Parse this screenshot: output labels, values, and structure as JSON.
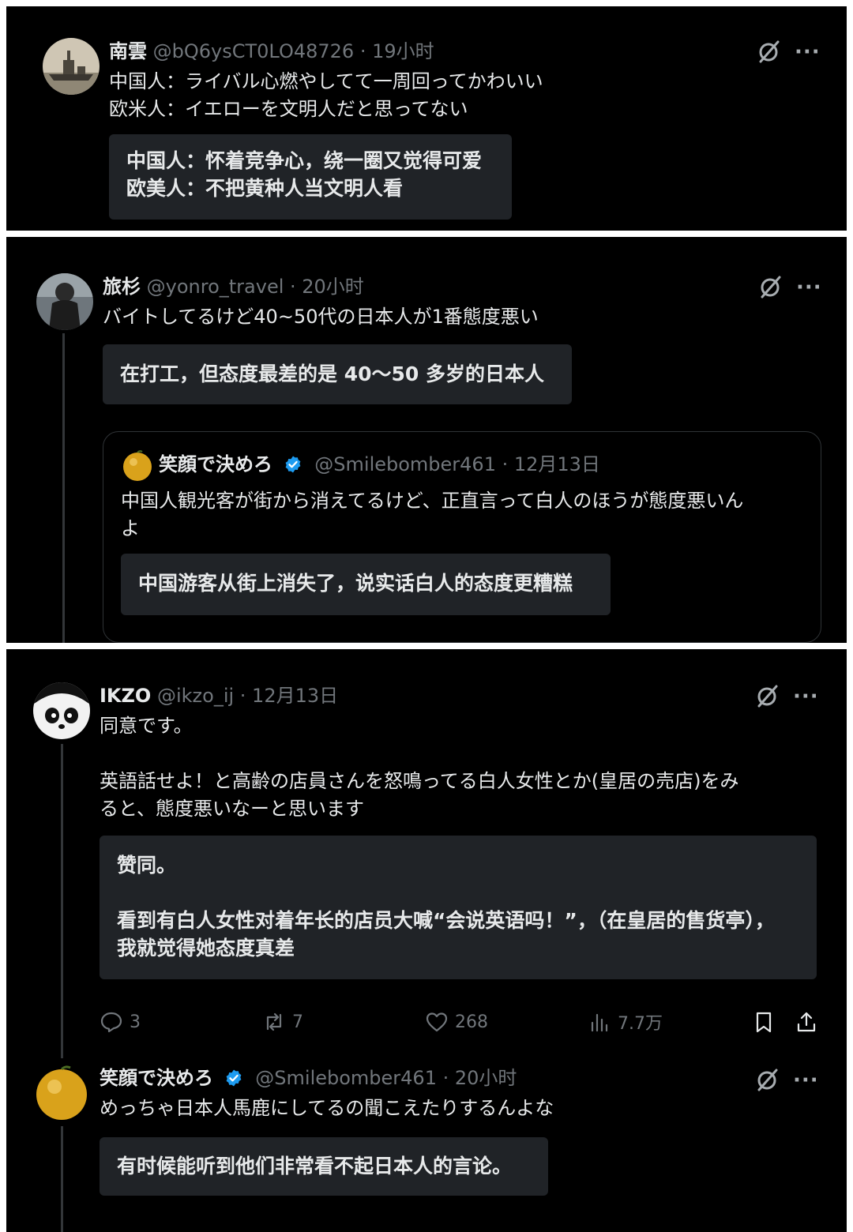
{
  "icons": {
    "grok": "grok-slash-icon",
    "more": "more-dots-icon",
    "verified": "verified-badge-icon",
    "reply": "reply-bubble-icon",
    "retweet": "retweet-icon",
    "like": "heart-icon",
    "views": "bar-chart-icon",
    "bookmark": "bookmark-icon",
    "share": "share-upload-icon"
  },
  "colors": {
    "background": "#000000",
    "translation_box": "#202327",
    "verified": "#1d9bf0",
    "muted": "#71767b"
  },
  "more_label": "···",
  "post1": {
    "name": "南雲",
    "meta": "@bQ6ysCT0LO48726 · 19小时",
    "lines": [
      "中国人：ライバル心燃やしてて一周回ってかわいい",
      "欧米人：イエローを文明人だと思ってない"
    ],
    "translation": [
      "中国人：怀着竞争心，绕一圈又觉得可爱",
      "欧美人：不把黄种人当文明人看"
    ]
  },
  "post2": {
    "name": "旅杉",
    "meta": "@yonro_travel · 20小时",
    "line": "バイトしてるけど40~50代の日本人が1番態度悪い",
    "translation": "在打工，但态度最差的是 40～50 多岁的日本人",
    "quote": {
      "name": "笑顔で決めろ",
      "meta": "@Smilebomber461 · 12月13日",
      "lines": [
        "中国人観光客が街から消えてるけど、正直言って白人のほうが態度悪いん",
        "よ"
      ],
      "translation": "中国游客从街上消失了，说实话白人的态度更糟糕"
    }
  },
  "post3": {
    "name": "IKZO",
    "meta": "@ikzo_ij · 12月13日",
    "line1": "同意です。",
    "lines": [
      "英語話せよ！と高齢の店員さんを怒鳴ってる白人女性とか(皇居の売店)をみ",
      "ると、態度悪いなーと思います"
    ],
    "translation": [
      "赞同。",
      "看到有白人女性对着年长的店员大喊“会说英语吗！”，（在皇居的售货亭），",
      "我就觉得她态度真差"
    ],
    "stats": {
      "replies": "3",
      "retweets": "7",
      "likes": "268",
      "views": "7.7万"
    }
  },
  "post4": {
    "name": "笑顔で決めろ",
    "meta": "@Smilebomber461 · 20小时",
    "line": "めっちゃ日本人馬鹿にしてるの聞こえたりするんよな",
    "translation": "有时候能听到他们非常看不起日本人的言论。"
  }
}
